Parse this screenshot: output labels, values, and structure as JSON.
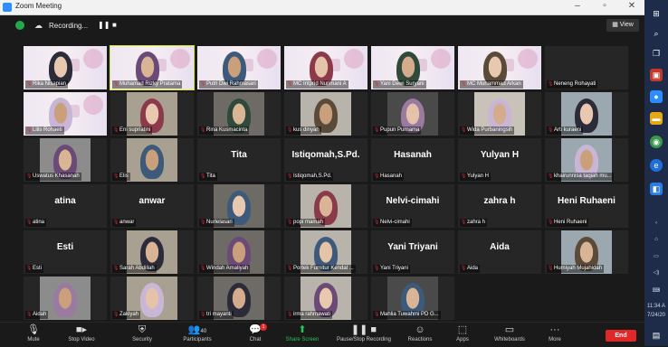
{
  "window": {
    "title": "Zoom Meeting"
  },
  "toolbar": {
    "recording_label": "Recording...",
    "view_label": "View"
  },
  "participants": [
    {
      "name": "Rika Nisapian",
      "type": "video-banner"
    },
    {
      "name": "Muhamad Rizky Pratama",
      "type": "video-banner",
      "active": true
    },
    {
      "name": "Putri Dwi Rahmasari",
      "type": "video-banner"
    },
    {
      "name": "MC Intprid Nurimani A",
      "type": "video-banner"
    },
    {
      "name": "Yani Dewi Suryani",
      "type": "video-banner"
    },
    {
      "name": "MC Muhammad Arkan",
      "type": "video-banner"
    },
    {
      "name": "Neneng Rohayati",
      "type": "dark"
    },
    {
      "name": "Lilis Rohaeti",
      "type": "video-banner"
    },
    {
      "name": "Eni supriatini",
      "type": "video"
    },
    {
      "name": "Rina Kusmacinta",
      "type": "video"
    },
    {
      "name": "kus dinyah",
      "type": "video"
    },
    {
      "name": "Pupun Purnama",
      "type": "video"
    },
    {
      "name": "Wida Purbaningsih",
      "type": "video"
    },
    {
      "name": "Arti kuraeni",
      "type": "video"
    },
    {
      "name": "Uswatus Khasanah",
      "type": "video"
    },
    {
      "name": "Elis",
      "type": "video"
    },
    {
      "name": "Tita",
      "type": "text",
      "display": "Tita"
    },
    {
      "name": "Istiqomah,S.Pd.",
      "type": "text",
      "display": "Istiqomah,S.Pd."
    },
    {
      "name": "Hasanah",
      "type": "text",
      "display": "Hasanah"
    },
    {
      "name": "Yulyan H",
      "type": "text",
      "display": "Yulyan H"
    },
    {
      "name": "khairunnisa taqiah mu...",
      "type": "video"
    },
    {
      "name": "atina",
      "type": "text",
      "display": "atina"
    },
    {
      "name": "anwar",
      "type": "text",
      "display": "anwar"
    },
    {
      "name": "Nurlelasari",
      "type": "video"
    },
    {
      "name": "popi mamah",
      "type": "video"
    },
    {
      "name": "Nelvi-cimahi",
      "type": "text",
      "display": "Nelvi-cimahi"
    },
    {
      "name": "zahra h",
      "type": "text",
      "display": "zahra h"
    },
    {
      "name": "Heni Ruhaeni",
      "type": "text",
      "display": "Heni Ruhaeni"
    },
    {
      "name": "Esti",
      "type": "text",
      "display": "Esti"
    },
    {
      "name": "Sarah Abdillah",
      "type": "video"
    },
    {
      "name": "Windah Amaliyah",
      "type": "video"
    },
    {
      "name": "Portek Furnitur Kendal ...",
      "type": "video"
    },
    {
      "name": "Yani Triyani",
      "type": "text",
      "display": "Yani Triyani"
    },
    {
      "name": "Aida",
      "type": "text",
      "display": "Aida"
    },
    {
      "name": "Humiyah Mujahidah",
      "type": "video"
    },
    {
      "name": "Aidah",
      "type": "video"
    },
    {
      "name": "Zakiyah",
      "type": "video"
    },
    {
      "name": "tri mayanti",
      "type": "video"
    },
    {
      "name": "irma rahmawati",
      "type": "video"
    },
    {
      "name": "Mahlia Tuwahmi PD G...",
      "type": "video"
    }
  ],
  "controls": {
    "mute": "Mute",
    "stop_video": "Stop Video",
    "security": "Security",
    "participants": "Participants",
    "participants_count": "40",
    "chat": "Chat",
    "chat_badge": "1",
    "share": "Share Screen",
    "pause_recording": "Pause/Stop Recording",
    "reactions": "Reactions",
    "apps": "Apps",
    "whiteboards": "Whiteboards",
    "more": "More",
    "end": "End"
  },
  "taskbar": {
    "time": "11:34 A",
    "date": "7/24/20"
  },
  "colors": {
    "active_speaker": "#d8e62b",
    "end": "#e02828",
    "share": "#23c552",
    "mute": "#e02828"
  }
}
